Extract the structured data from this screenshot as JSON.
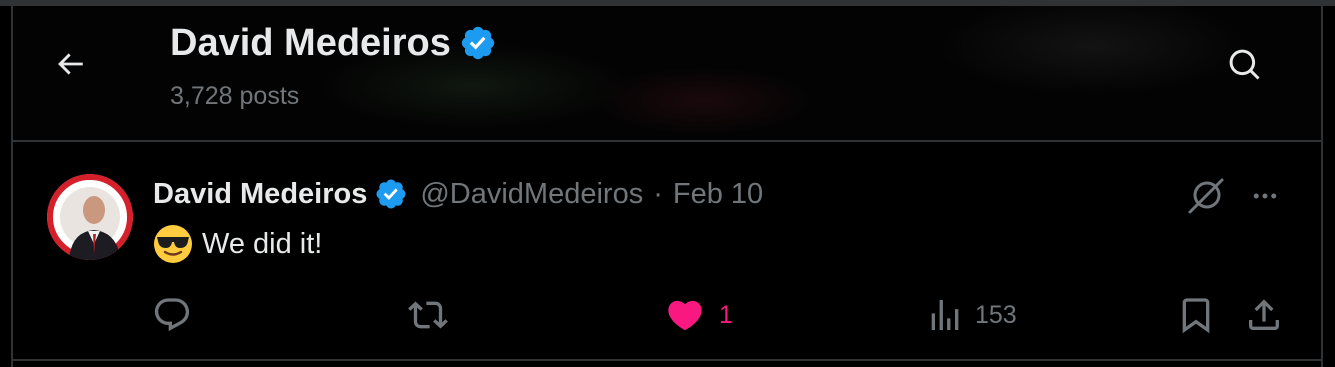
{
  "header": {
    "back_icon": "arrow-left-icon",
    "profile_name": "David Medeiros",
    "verified_icon": "verified-badge-icon",
    "post_count": "3,728 posts",
    "search_icon": "search-icon"
  },
  "tweet": {
    "author_name": "David Medeiros",
    "author_handle": "@DavidMedeiros",
    "separator": "·",
    "date": "Feb 10",
    "emoji": "😎",
    "text": "We did it!",
    "actions": {
      "reply": {
        "icon": "reply-icon",
        "count": ""
      },
      "retweet": {
        "icon": "retweet-icon",
        "count": ""
      },
      "like": {
        "icon": "heart-filled-icon",
        "count": "1",
        "liked": true
      },
      "views": {
        "icon": "views-chart-icon",
        "count": "153"
      },
      "bookmark": {
        "icon": "bookmark-icon"
      },
      "share": {
        "icon": "share-icon"
      }
    },
    "grok_icon": "grok-icon",
    "more_icon": "more-dots-icon"
  },
  "colors": {
    "background": "#000000",
    "text_primary": "#e7e9ea",
    "text_secondary": "#71767b",
    "border": "#2f3336",
    "verified_blue": "#1d9bf0",
    "like_pink": "#f91880"
  }
}
